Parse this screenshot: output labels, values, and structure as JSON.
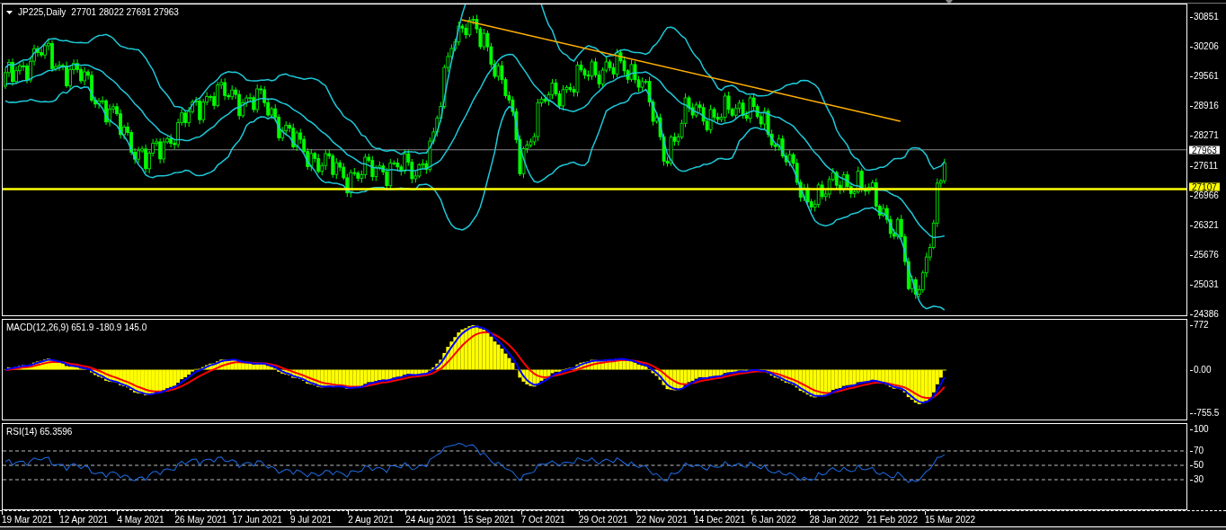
{
  "header": {
    "symbol": "JP225,Daily",
    "ohlc": "27701 28022 27691 27963"
  },
  "price_axis": {
    "ticks": [
      "30851",
      "30206",
      "29561",
      "28916",
      "28271",
      "27611",
      "26966",
      "26321",
      "25676",
      "25031",
      "24386"
    ],
    "current_price": "27963",
    "level_price": "27107"
  },
  "macd": {
    "label": "MACD(12,26,9) 651.9 -180.9 145.0",
    "ticks": [
      "772",
      "0.00",
      "-755.5"
    ]
  },
  "rsi": {
    "label": "RSI(14) 65.3596",
    "ticks": [
      "100",
      "70",
      "50",
      "30"
    ]
  },
  "time_axis": [
    "19 Mar 2021",
    "12 Apr 2021",
    "4 May 2021",
    "26 May 2021",
    "17 Jun 2021",
    "9 Jul 2021",
    "2 Aug 2021",
    "24 Aug 2021",
    "15 Sep 2021",
    "7 Oct 2021",
    "29 Oct 2021",
    "22 Nov 2021",
    "14 Dec 2021",
    "6 Jan 2022",
    "28 Jan 2022",
    "21 Feb 2022",
    "15 Mar 2022"
  ]
}
